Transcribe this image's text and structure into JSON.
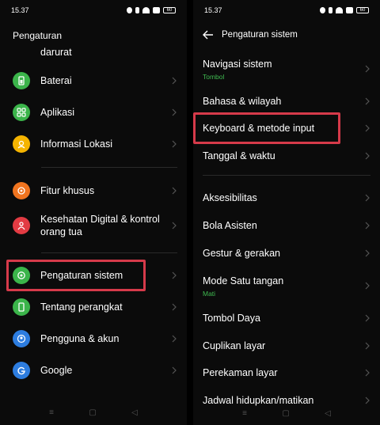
{
  "status": {
    "time_left": "15.37",
    "time_right": "15.37",
    "battery": "60"
  },
  "left": {
    "title": "Pengaturan",
    "items": [
      {
        "label": "darurat",
        "icon": "emergency-icon"
      },
      {
        "label": "Baterai",
        "icon": "battery-icon",
        "color": "#3bb44a"
      },
      {
        "label": "Aplikasi",
        "icon": "apps-icon",
        "color": "#3bb44a"
      },
      {
        "label": "Informasi Lokasi",
        "icon": "location-icon",
        "color": "#f5b400"
      },
      {
        "label": "Fitur khusus",
        "icon": "special-features-icon",
        "color": "#f0741f"
      },
      {
        "label": "Kesehatan Digital & kontrol orang tua",
        "icon": "digital-wellbeing-icon",
        "color": "#e23b43"
      },
      {
        "label": "Pengaturan sistem",
        "icon": "system-settings-icon",
        "color": "#3bb44a"
      },
      {
        "label": "Tentang perangkat",
        "icon": "about-phone-icon",
        "color": "#3bb44a"
      },
      {
        "label": "Pengguna & akun",
        "icon": "user-account-icon",
        "color": "#2d7de0"
      },
      {
        "label": "Google",
        "icon": "google-icon",
        "color": "#2d7de0"
      }
    ]
  },
  "right": {
    "title": "Pengaturan sistem",
    "items": [
      {
        "label": "Navigasi sistem",
        "sub": "Tombol"
      },
      {
        "label": "Bahasa & wilayah"
      },
      {
        "label": "Keyboard & metode input"
      },
      {
        "label": "Tanggal & waktu"
      },
      {
        "label": "Aksesibilitas"
      },
      {
        "label": "Bola Asisten"
      },
      {
        "label": "Gestur & gerakan"
      },
      {
        "label": "Mode Satu tangan",
        "sub": "Mati"
      },
      {
        "label": "Tombol Daya"
      },
      {
        "label": "Cuplikan layar"
      },
      {
        "label": "Perekaman layar"
      },
      {
        "label": "Jadwal hidupkan/matikan"
      }
    ]
  },
  "navbar": {
    "menu": "≡",
    "home": "▢",
    "back": "◁"
  },
  "colors": {
    "highlight": "#d63a4a",
    "accent_green": "#3fb950"
  }
}
